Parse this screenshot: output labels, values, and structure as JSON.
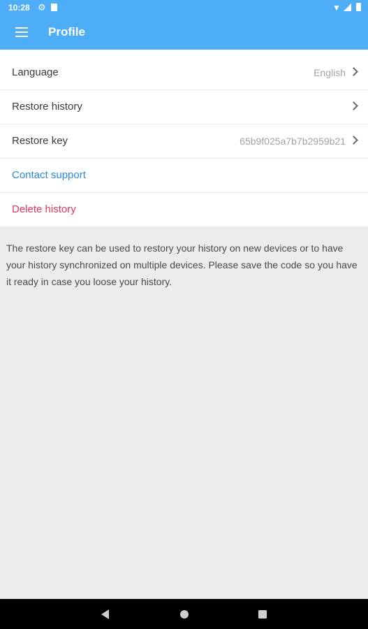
{
  "status": {
    "time": "10:28"
  },
  "appbar": {
    "title": "Profile"
  },
  "settings": {
    "language_label": "Language",
    "language_value": "English",
    "restore_history_label": "Restore history",
    "restore_key_label": "Restore key",
    "restore_key_value": "65b9f025a7b7b2959b21",
    "contact_support_label": "Contact support",
    "delete_history_label": "Delete history"
  },
  "info_text": "The restore key can be used to restory your history on new devices or to have your history synchronized on multiple devices. Please save the code so you have it ready in case you loose your history.",
  "colors": {
    "appbar": "#4dadf7",
    "link": "#2b8ad6",
    "danger": "#e0365c"
  }
}
